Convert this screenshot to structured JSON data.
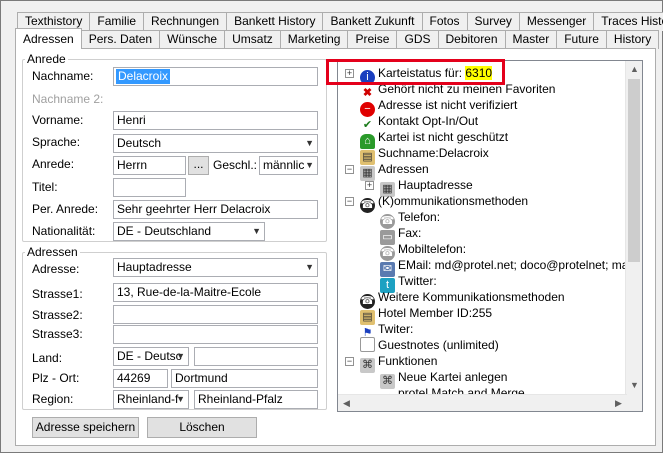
{
  "tabs_top": [
    "Texthistory",
    "Familie",
    "Rechnungen",
    "Bankett History",
    "Bankett Zukunft",
    "Fotos",
    "Survey",
    "Messenger",
    "Traces History"
  ],
  "tabs_bottom": [
    "Adressen",
    "Pers. Daten",
    "Wünsche",
    "Umsatz",
    "Marketing",
    "Preise",
    "GDS",
    "Debitoren",
    "Master",
    "Future",
    "History"
  ],
  "anrede_group": {
    "legend": "Anrede",
    "nachname_label": "Nachname:",
    "nachname_value": "Delacroix",
    "nachname2_label": "Nachname 2:",
    "vorname_label": "Vorname:",
    "vorname_value": "Henri",
    "sprache_label": "Sprache:",
    "sprache_value": "Deutsch",
    "anrede_label": "Anrede:",
    "anrede_value": "Herrn",
    "dots_label": "...",
    "geschl_label": "Geschl.:",
    "geschl_value": "männlic",
    "titel_label": "Titel:",
    "per_anrede_label": "Per. Anrede:",
    "per_anrede_value": "Sehr geehrter Herr Delacroix",
    "nationalitaet_label": "Nationalität:",
    "nationalitaet_value": "DE - Deutschland"
  },
  "adressen_group": {
    "legend": "Adressen",
    "adresse_label": "Adresse:",
    "adresse_value": "Hauptadresse",
    "strasse1_label": "Strasse1:",
    "strasse1_value": "13, Rue-de-la-Maitre-Ecole",
    "strasse2_label": "Strasse2:",
    "strasse3_label": "Strasse3:",
    "land_label": "Land:",
    "land_value": "DE - Deutsc",
    "plz_label": "Plz - Ort:",
    "plz_value": "44269",
    "ort_value": "Dortmund",
    "region_label": "Region:",
    "region_value": "Rheinland-f",
    "region_text": "Rheinland-Pfalz"
  },
  "buttons": {
    "save": "Adresse speichern",
    "delete": "Löschen"
  },
  "tree": {
    "karteistatus_prefix": "Karteistatus für: ",
    "karteistatus_number": "6310",
    "items": [
      "Gehört nicht zu meinen Favoriten",
      "Adresse ist nicht verifiziert",
      "Kontakt Opt-In/Out",
      "Kartei ist nicht geschützt",
      "Suchname:Delacroix",
      "Adressen",
      "Hauptadresse",
      "(K)ommunikationsmethoden",
      "Telefon:",
      "Fax:",
      "Mobiltelefon:",
      "EMail: md@protel.net; doco@protelnet; martin@",
      "Twitter:",
      "Weitere Kommunikationsmethoden",
      "Hotel Member ID:255",
      "Twiter:",
      "Guestnotes (unlimited)",
      "Funktionen",
      "Neue Kartei anlegen",
      "protel Match and Merge"
    ]
  },
  "colors": {
    "highlight": "#ffff00",
    "redbox": "#e4001b",
    "selection": "#3399ff"
  }
}
